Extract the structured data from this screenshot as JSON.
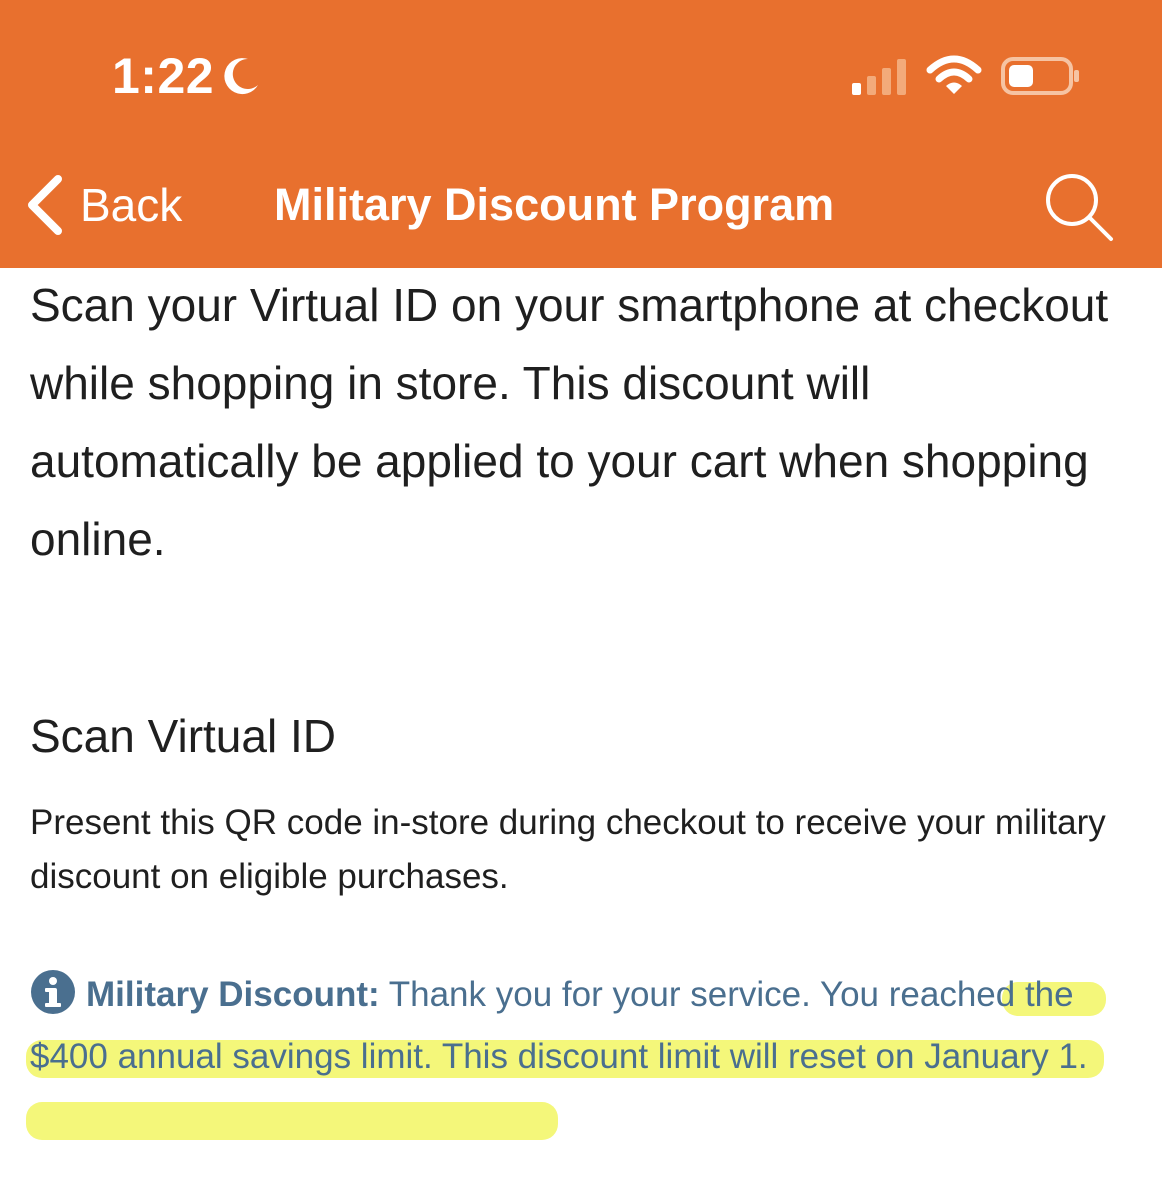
{
  "status_bar": {
    "time": "1:22",
    "moon_icon": "moon-icon",
    "signal_icon": "cellular-signal-icon",
    "wifi_icon": "wifi-icon",
    "battery_icon": "battery-icon"
  },
  "nav": {
    "back_label": "Back",
    "title": "Military Discount Program",
    "search_icon": "search-icon"
  },
  "intro": {
    "text": "Scan your Virtual ID on your smartphone at checkout while shopping in store. This discount will automatically be applied to your cart when shopping online."
  },
  "scan_section": {
    "title": "Scan Virtual ID",
    "description": "Present this QR code in-store during checkout to receive your military discount on eligible purchases."
  },
  "notice": {
    "icon": "info-icon",
    "label": "Military Discount:",
    "message": "Thank you for your service. You reached the $400 annual savings limit. This discount limit will reset on January 1."
  },
  "colors": {
    "header_bg": "#e8702e",
    "header_text": "#ffffff",
    "body_text": "#1f1f1f",
    "notice_text": "#4a6f8f",
    "highlight": "#f0f446"
  }
}
